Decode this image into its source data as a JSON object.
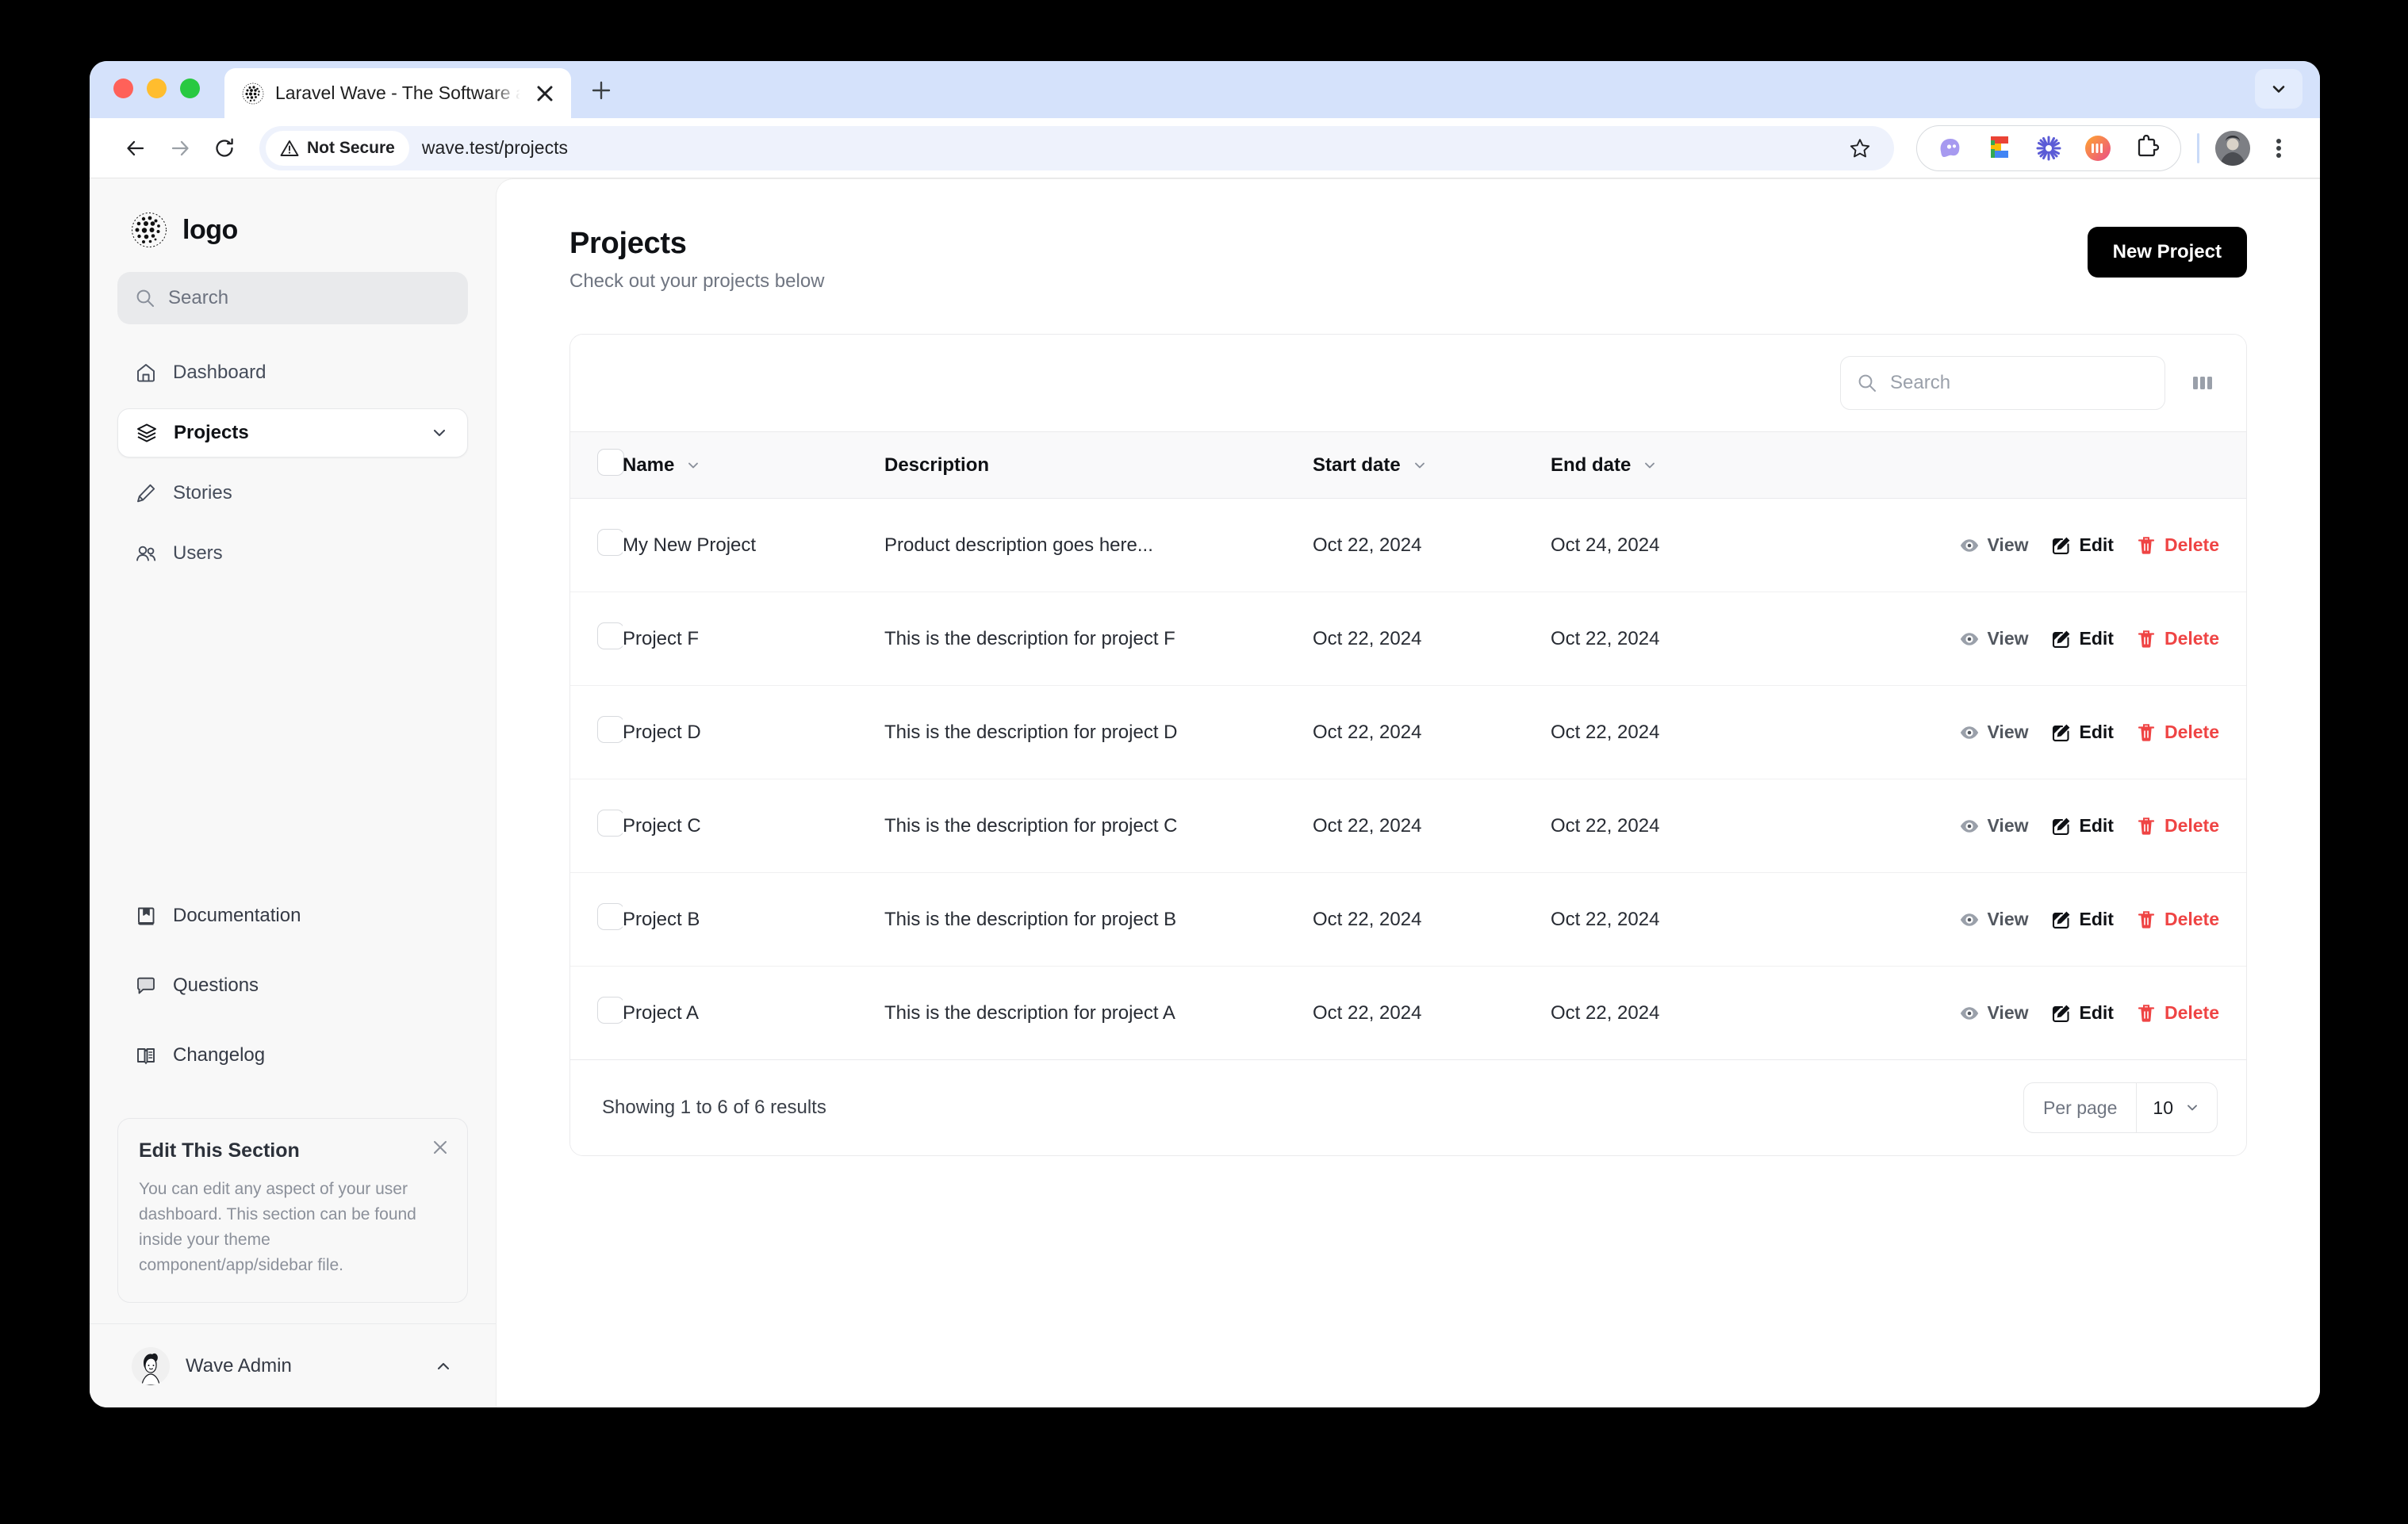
{
  "browser": {
    "tab": {
      "title": "Laravel Wave - The Software a",
      "favicon_icon": "globe-dots-favicon",
      "close_icon": "close-icon"
    },
    "new_tab_icon": "plus-icon",
    "tab_list_icon": "chevron-down-icon",
    "nav": {
      "back_icon": "arrow-left-icon",
      "forward_icon": "arrow-right-icon",
      "reload_icon": "reload-icon"
    },
    "omnibox": {
      "security_label": "Not Secure",
      "security_icon": "warning-triangle-icon",
      "url": "wave.test/projects",
      "star_icon": "star-icon"
    },
    "extensions": [
      {
        "name": "ghost-extension-icon"
      },
      {
        "name": "figma-extension-icon"
      },
      {
        "name": "asterisk-extension-icon"
      },
      {
        "name": "gradient-circle-extension-icon"
      },
      {
        "name": "puzzle-extensions-icon"
      }
    ],
    "profile_icon": "user-avatar",
    "menu_icon": "three-dots-vertical-icon"
  },
  "sidebar": {
    "brand": {
      "label": "logo",
      "icon": "globe-dots-logo"
    },
    "search": {
      "placeholder": "Search",
      "icon": "search-icon"
    },
    "primary_items": [
      {
        "label": "Dashboard",
        "icon": "home-icon",
        "active": false,
        "expandable": false
      },
      {
        "label": "Projects",
        "icon": "layers-icon",
        "active": true,
        "expandable": true
      },
      {
        "label": "Stories",
        "icon": "pencil-icon",
        "active": false,
        "expandable": false
      },
      {
        "label": "Users",
        "icon": "users-icon",
        "active": false,
        "expandable": false
      }
    ],
    "secondary_items": [
      {
        "label": "Documentation",
        "icon": "book-bookmark-icon"
      },
      {
        "label": "Questions",
        "icon": "chat-bubble-icon"
      },
      {
        "label": "Changelog",
        "icon": "open-book-icon"
      }
    ],
    "edit_card": {
      "title": "Edit This Section",
      "body": "You can edit any aspect of your user dashboard. This section can be found inside your theme component/app/sidebar file.",
      "close_icon": "close-icon"
    },
    "user": {
      "name": "Wave Admin",
      "avatar_icon": "user-avatar",
      "chevron_icon": "chevron-up-icon"
    }
  },
  "main": {
    "title": "Projects",
    "subtitle": "Check out your projects below",
    "new_project_label": "New Project",
    "toolbar": {
      "search_placeholder": "Search",
      "search_icon": "search-icon",
      "columns_icon": "columns-icon"
    },
    "table": {
      "select_all_icon": "checkbox-unchecked-icon",
      "columns": [
        {
          "label": "Name",
          "sortable": true
        },
        {
          "label": "Description",
          "sortable": false
        },
        {
          "label": "Start date",
          "sortable": true
        },
        {
          "label": "End date",
          "sortable": true
        }
      ],
      "row_actions": [
        {
          "label": "View",
          "icon": "eye-icon",
          "color": "#52575f"
        },
        {
          "label": "Edit",
          "icon": "pencil-square-icon",
          "color": "#0f1115"
        },
        {
          "label": "Delete",
          "icon": "trash-icon",
          "color": "#ef4444"
        }
      ],
      "rows": [
        {
          "name": "My New Project",
          "description": "Product description goes here...",
          "start_date": "Oct 22, 2024",
          "end_date": "Oct 24, 2024"
        },
        {
          "name": "Project F",
          "description": "This is the description for project F",
          "start_date": "Oct 22, 2024",
          "end_date": "Oct 22, 2024"
        },
        {
          "name": "Project D",
          "description": "This is the description for project D",
          "start_date": "Oct 22, 2024",
          "end_date": "Oct 22, 2024"
        },
        {
          "name": "Project C",
          "description": "This is the description for project C",
          "start_date": "Oct 22, 2024",
          "end_date": "Oct 22, 2024"
        },
        {
          "name": "Project B",
          "description": "This is the description for project B",
          "start_date": "Oct 22, 2024",
          "end_date": "Oct 22, 2024"
        },
        {
          "name": "Project A",
          "description": "This is the description for project A",
          "start_date": "Oct 22, 2024",
          "end_date": "Oct 22, 2024"
        }
      ]
    },
    "footer": {
      "results_text": "Showing 1 to 6 of 6 results",
      "per_page_label": "Per page",
      "per_page_value": "10",
      "per_page_chevron": "chevron-down-icon"
    }
  },
  "colors": {
    "accent_black": "#000000",
    "danger": "#ef4444",
    "tab_strip": "#d5e2fb",
    "sidebar_bg": "#f8f8f8"
  }
}
